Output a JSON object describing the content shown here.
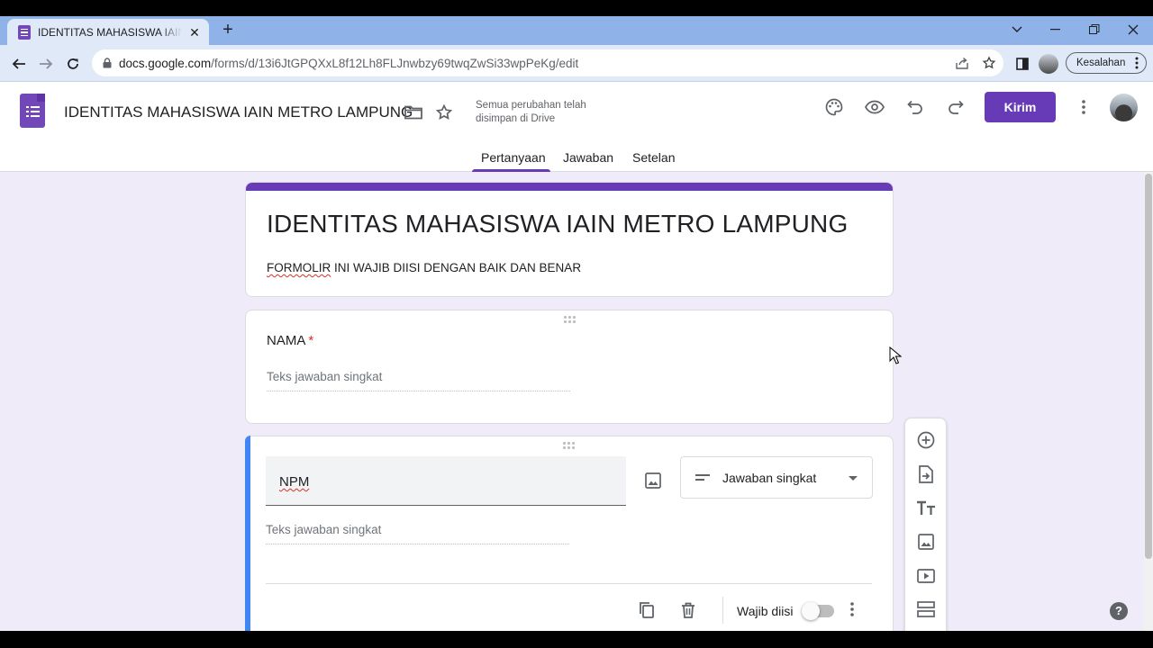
{
  "browser": {
    "tab_title": "IDENTITAS MAHASISWA IAIN METRO LAMPUNG",
    "tab_close": "✕",
    "new_tab": "+",
    "url_host": "docs.google.com",
    "url_path": "/forms/d/13i6JtGPQXxL8f12Lh8FLJnwbzy69twqZwSi33wpPeKg/edit",
    "profile_label": "Kesalahan",
    "accent_color": "#8fb3e8"
  },
  "header": {
    "doc_title": "IDENTITAS MAHASISWA IAIN METRO LAMPUNG",
    "save_status": "Semua perubahan telah disimpan di Drive",
    "send_label": "Kirim",
    "brand_color": "#673ab7"
  },
  "tabs": [
    {
      "label": "Pertanyaan",
      "active": true
    },
    {
      "label": "Jawaban",
      "active": false
    },
    {
      "label": "Setelan",
      "active": false
    }
  ],
  "form": {
    "title": "IDENTITAS MAHASISWA IAIN METRO LAMPUNG",
    "description_word1": "FORMOLIR",
    "description_rest": " INI WAJIB DIISI DENGAN BAIK DAN BENAR",
    "questions": [
      {
        "title": "NAMA",
        "required_mark": "*",
        "answer_placeholder": "Teks jawaban singkat"
      },
      {
        "title": "NPM",
        "answer_placeholder": "Teks jawaban singkat",
        "type_label": "Jawaban singkat",
        "required_label": "Wajib diisi",
        "required": false
      }
    ]
  },
  "icons": {
    "toolbar": [
      "add-question-icon",
      "import-questions-icon",
      "title-text-icon",
      "add-image-icon",
      "add-video-icon",
      "add-section-icon"
    ],
    "header": [
      "folder-icon",
      "star-icon",
      "palette-icon",
      "preview-eye-icon",
      "undo-icon",
      "redo-icon",
      "more-vert-icon"
    ]
  },
  "help": "?"
}
